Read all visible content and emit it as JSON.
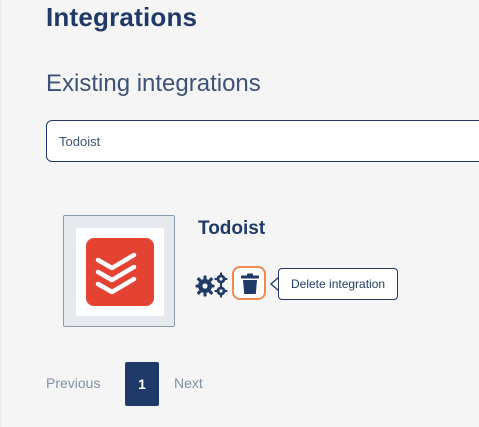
{
  "header": {
    "title": "Integrations",
    "subtitle": "Existing integrations"
  },
  "search": {
    "value": "Todoist"
  },
  "integrations": [
    {
      "name": "Todoist",
      "logo_icon": "todoist-logo",
      "logo_color": "#e44232",
      "actions": {
        "settings_icon": "gears-icon",
        "delete_icon": "trash-icon"
      }
    }
  ],
  "tooltip": {
    "text": "Delete integration"
  },
  "pagination": {
    "previous_label": "Previous",
    "current_page": "1",
    "next_label": "Next"
  },
  "colors": {
    "primary": "#1f3a68",
    "highlight": "#ee8a52",
    "background": "#f5f5f5"
  }
}
